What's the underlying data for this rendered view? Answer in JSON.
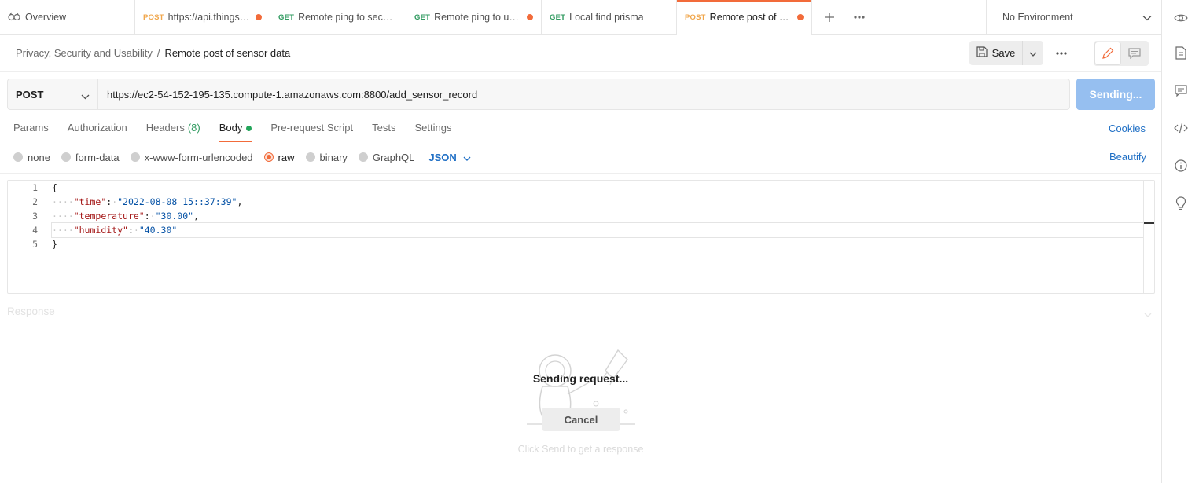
{
  "tabs": {
    "overview_label": "Overview",
    "items": [
      {
        "method": "POST",
        "title": "https://api.thingspeak",
        "unsaved": true
      },
      {
        "method": "GET",
        "title": "Remote ping to secured I",
        "unsaved": true
      },
      {
        "method": "GET",
        "title": "Remote ping to unsecu",
        "unsaved": true
      },
      {
        "method": "GET",
        "title": "Local find prisma",
        "unsaved": false
      },
      {
        "method": "POST",
        "title": "Remote post of senso",
        "unsaved": true
      }
    ],
    "active_index": 4
  },
  "environment": {
    "selected": "No Environment"
  },
  "breadcrumb": {
    "parent": "Privacy, Security and Usability",
    "separator": "/",
    "current": "Remote post of sensor data"
  },
  "toolbar": {
    "save_label": "Save"
  },
  "request": {
    "method": "POST",
    "url": "https://ec2-54-152-195-135.compute-1.amazonaws.com:8800/add_sensor_record",
    "send_label": "Sending..."
  },
  "request_tabs": {
    "params": "Params",
    "authorization": "Authorization",
    "headers": "Headers",
    "headers_count": "(8)",
    "body": "Body",
    "pre_request": "Pre-request Script",
    "tests": "Tests",
    "settings": "Settings",
    "cookies": "Cookies"
  },
  "body_types": {
    "none": "none",
    "form_data": "form-data",
    "urlencoded": "x-www-form-urlencoded",
    "raw": "raw",
    "binary": "binary",
    "graphql": "GraphQL",
    "selected": "raw",
    "language": "JSON",
    "beautify": "Beautify"
  },
  "editor": {
    "line_numbers": [
      "1",
      "2",
      "3",
      "4",
      "5"
    ],
    "open_brace": "{",
    "close_brace": "}",
    "fields": [
      {
        "key": "\"time\"",
        "value": "\"2022-08-08 15::37:39\"",
        "trail": ","
      },
      {
        "key": "\"temperature\"",
        "value": "\"30.00\"",
        "trail": ","
      },
      {
        "key": "\"humidity\"",
        "value": "\"40.30\"",
        "trail": ""
      }
    ],
    "current_line": 4
  },
  "response": {
    "label": "Response",
    "sending_text": "Sending request...",
    "cancel_label": "Cancel",
    "hint": "Click Send to get a response"
  },
  "colors": {
    "accent": "#f26b3a",
    "link": "#1f6fc5",
    "send_disabled": "#96bff0",
    "post": "#f0a64b",
    "get": "#2f9a5f"
  }
}
